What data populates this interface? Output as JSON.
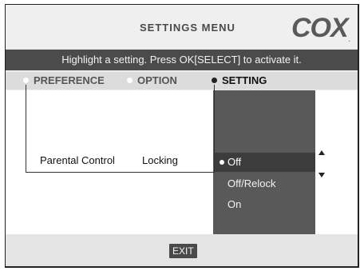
{
  "header": {
    "title": "SETTINGS MENU",
    "brand": "COX",
    "brand_mark": "."
  },
  "instructions": "Highlight a setting. Press OK[SELECT] to activate it.",
  "tabs": [
    {
      "label": "PREFERENCE",
      "active": false
    },
    {
      "label": "OPTION",
      "active": false
    },
    {
      "label": "SETTING",
      "active": true
    }
  ],
  "row": {
    "preference": "Parental Control",
    "option": "Locking"
  },
  "settings": [
    {
      "label": "Off",
      "selected": true
    },
    {
      "label": "Off/Relock",
      "selected": false
    },
    {
      "label": "On",
      "selected": false
    }
  ],
  "footer": {
    "exit_label": "EXIT"
  },
  "colors": {
    "instruction_bar": "#4b4b4b",
    "setting_panel": "#595959",
    "selected_option": "#3c3c3c"
  }
}
